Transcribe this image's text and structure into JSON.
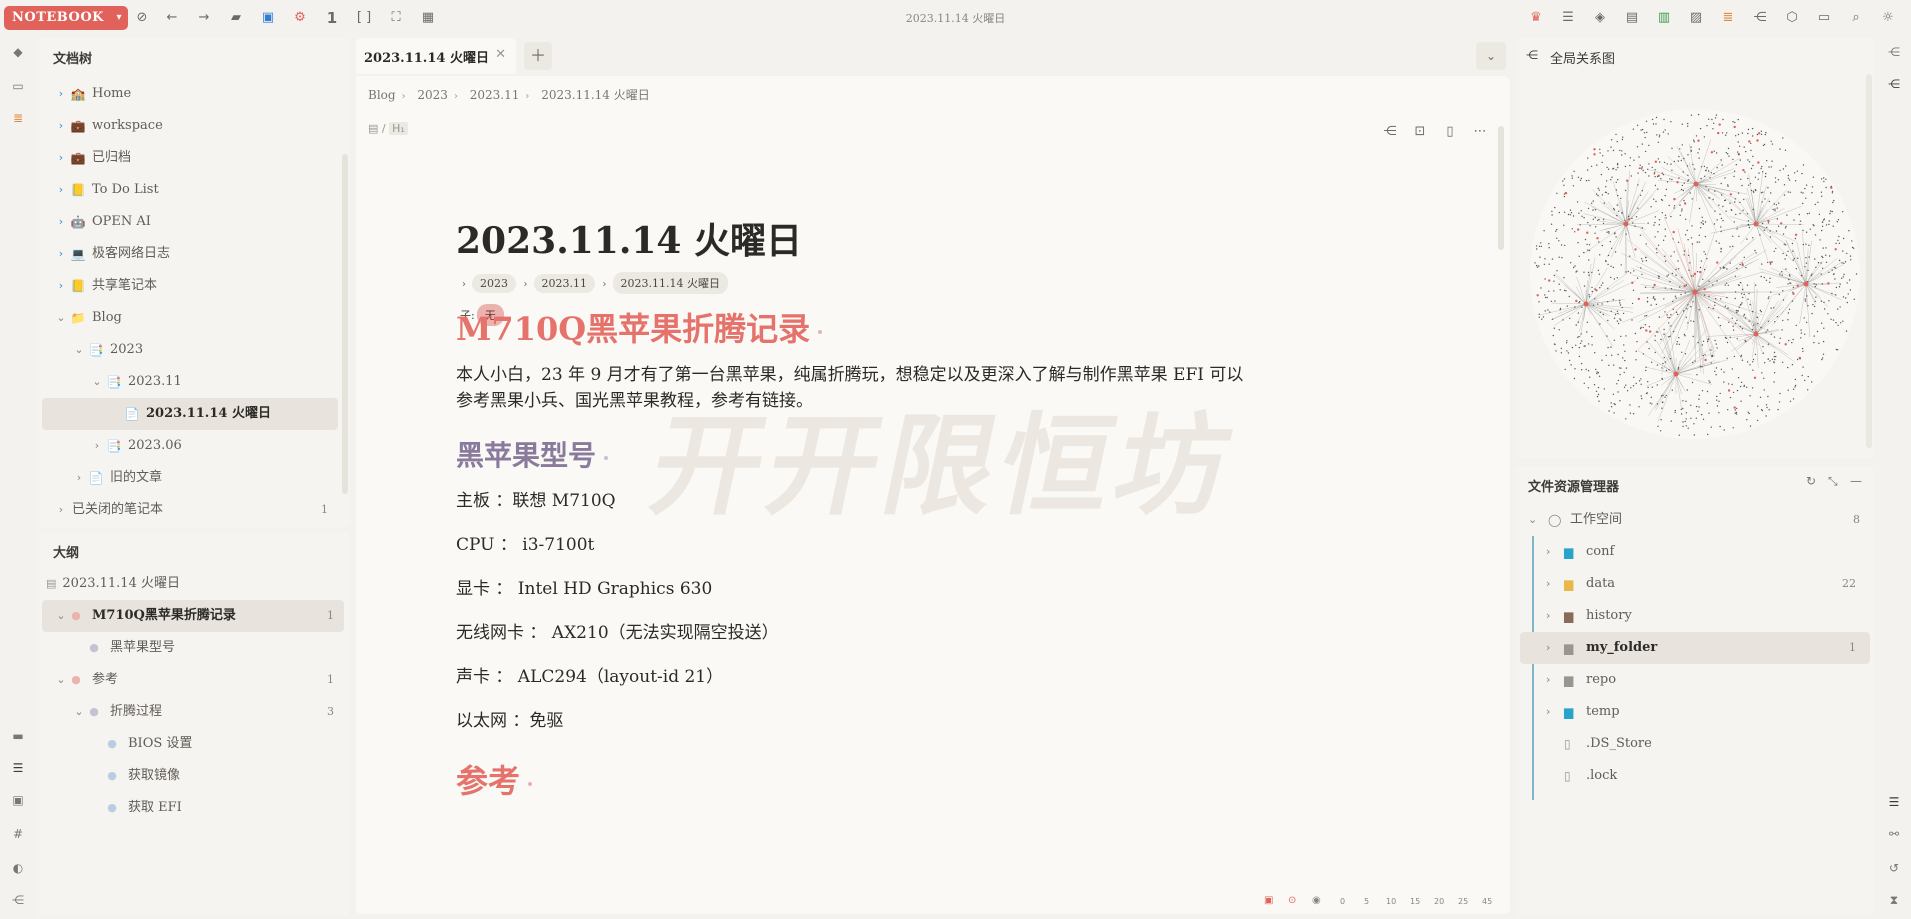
{
  "topbar": {
    "workspace_label": "NOTEBOOK",
    "window_title": "2023.11.14 火曜日",
    "left_icons": [
      "sync-off-icon",
      "back-icon",
      "forward-icon",
      "box-icon",
      "block-icon",
      "gear-icon",
      "count-icon",
      "bracket-icon",
      "scan-icon",
      "calendar-icon"
    ],
    "count_badge": "1",
    "right_icons": [
      "crown-icon",
      "list-icon",
      "paint-icon",
      "book-icon",
      "chart-icon",
      "image-icon",
      "tasks-icon",
      "graph-icon",
      "puzzle-icon",
      "terminal-icon",
      "search-icon",
      "sun-icon"
    ]
  },
  "filetree": {
    "title": "文档树",
    "items": [
      {
        "label": "Home",
        "icon": "🏫",
        "level": 0,
        "expanded": false
      },
      {
        "label": "workspace",
        "icon": "💼",
        "level": 0,
        "expanded": false
      },
      {
        "label": "已归档",
        "icon": "💼",
        "level": 0,
        "expanded": false
      },
      {
        "label": "To Do List",
        "icon": "📒",
        "level": 0,
        "expanded": false
      },
      {
        "label": "OPEN AI",
        "icon": "🤖",
        "level": 0,
        "expanded": false
      },
      {
        "label": "极客网络日志",
        "icon": "💻",
        "level": 0,
        "expanded": false
      },
      {
        "label": "共享笔记本",
        "icon": "📒",
        "level": 0,
        "expanded": false
      },
      {
        "label": "Blog",
        "icon": "📁",
        "level": 0,
        "expanded": true
      },
      {
        "label": "2023",
        "icon": "📑",
        "level": 1,
        "expanded": true
      },
      {
        "label": "2023.11",
        "icon": "📑",
        "level": 2,
        "expanded": true
      },
      {
        "label": "2023.11.14 火曜日",
        "icon": "📄",
        "level": 3,
        "expanded": null,
        "active": true
      },
      {
        "label": "2023.06",
        "icon": "📑",
        "level": 2,
        "expanded": false
      },
      {
        "label": "旧的文章",
        "icon": "📄",
        "level": 1,
        "expanded": false
      }
    ],
    "closed": {
      "label": "已关闭的笔记本",
      "count": "1"
    }
  },
  "outline": {
    "title": "大纲",
    "root": "2023.11.14 火曜日",
    "items": [
      {
        "label": "M710Q黑苹果折腾记录",
        "level": 0,
        "count": "1",
        "active": true,
        "expanded": true
      },
      {
        "label": "黑苹果型号",
        "level": 1,
        "count": "",
        "active": false,
        "expanded": null
      },
      {
        "label": "参考",
        "level": 0,
        "count": "1",
        "active": false,
        "expanded": true
      },
      {
        "label": "折腾过程",
        "level": 1,
        "count": "3",
        "active": false,
        "expanded": true
      },
      {
        "label": "BIOS 设置",
        "level": 2,
        "count": "",
        "active": false,
        "expanded": null
      },
      {
        "label": "获取镜像",
        "level": 2,
        "count": "",
        "active": false,
        "expanded": null
      },
      {
        "label": "获取 EFI",
        "level": 2,
        "count": "",
        "active": false,
        "expanded": null
      }
    ]
  },
  "tab": {
    "label": "2023.11.14 火曜日"
  },
  "editor": {
    "breadcrumb": [
      "Blog",
      "2023",
      "2023.11",
      "2023.11.14 火曜日"
    ],
    "doc_type": "H₁",
    "title": "2023.11.14 火曜日",
    "crumb_pills": [
      "2023",
      "2023.11",
      "2023.11.14 火曜日"
    ],
    "child_label": "子:",
    "child_none": "无",
    "watermark": "开开限恒坊",
    "h2_1": "M710Q黑苹果折腾记录",
    "intro_1": "本人小白，23 年 9 月才有了第一台黑苹果，纯属折腾玩，想稳定以及更深入了解与制作黑苹果 EFI 可以",
    "intro_2": "参考黑果小兵、国光黑苹果教程，参考有链接。",
    "h3_1": "黑苹果型号",
    "specs": [
      "主板 ：联想 M710Q",
      "CPU ： i3-7100t",
      "显卡 ： Intel HD Graphics 630",
      "无线网卡 ： AX210（无法实现隔空投送）",
      "声卡 ： ALC294（layout-id 21）",
      "以太网 ：免驱"
    ],
    "h2_2": "参考"
  },
  "status_bar": [
    "0",
    "5",
    "10",
    "15",
    "20",
    "25",
    "45"
  ],
  "graph": {
    "title": "全局关系图"
  },
  "files": {
    "title": "文件资源管理器",
    "root": {
      "label": "工作空间",
      "count": "8"
    },
    "items": [
      {
        "label": "conf",
        "icon": "folder-icon",
        "color": "#2aa3c9",
        "count": ""
      },
      {
        "label": "data",
        "icon": "folder-icon",
        "color": "#e8b84a",
        "count": "22"
      },
      {
        "label": "history",
        "icon": "folder-icon",
        "color": "#8a6a5a",
        "count": ""
      },
      {
        "label": "my_folder",
        "icon": "folder-icon",
        "color": "#9a968f",
        "count": "1",
        "active": true
      },
      {
        "label": "repo",
        "icon": "folder-icon",
        "color": "#9a968f",
        "count": ""
      },
      {
        "label": "temp",
        "icon": "folder-icon",
        "color": "#2aa3c9",
        "count": ""
      },
      {
        "label": ".DS_Store",
        "icon": "file-icon",
        "color": "#9a968f",
        "count": ""
      },
      {
        "label": ".lock",
        "icon": "file-icon",
        "color": "#9a968f",
        "count": ""
      }
    ]
  },
  "colors": {
    "accent": "#e0625a",
    "heading": "#e5736b",
    "subheading": "#8a7b9d"
  }
}
